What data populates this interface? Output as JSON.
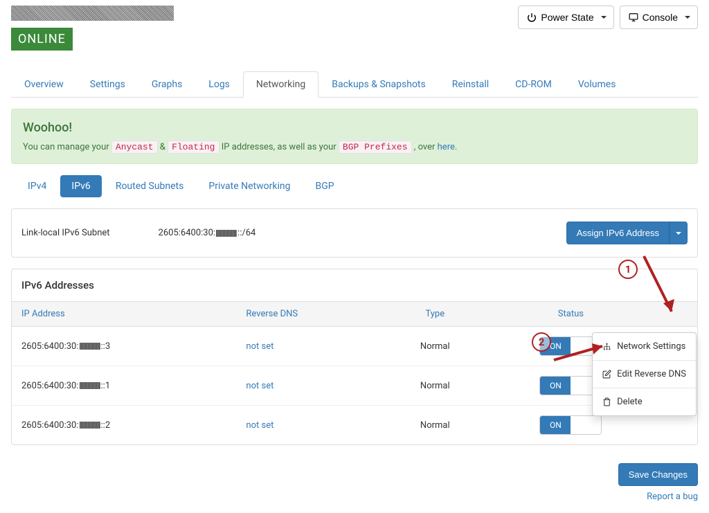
{
  "header": {
    "status_badge": "ONLINE",
    "power_btn": "Power State",
    "console_btn": "Console"
  },
  "tabs": [
    "Overview",
    "Settings",
    "Graphs",
    "Logs",
    "Networking",
    "Backups & Snapshots",
    "Reinstall",
    "CD-ROM",
    "Volumes"
  ],
  "alert": {
    "title": "Woohoo!",
    "pre": "You can manage your",
    "tag1": "Anycast",
    "amp": "&",
    "tag2": "Floating",
    "mid": "IP addresses, as well as your",
    "tag3": "BGP Prefixes",
    "post": ", over",
    "link": "here",
    "dot": "."
  },
  "subtabs": [
    "IPv4",
    "IPv6",
    "Routed Subnets",
    "Private Networking",
    "BGP"
  ],
  "subnet_panel": {
    "label": "Link-local IPv6 Subnet",
    "value_pre": "2605:6400:30:",
    "value_post": "::/64",
    "assign_btn": "Assign IPv6 Address"
  },
  "addresses_panel": {
    "heading": "IPv6 Addresses",
    "cols": [
      "IP Address",
      "Reverse DNS",
      "Type",
      "Status"
    ],
    "rows": [
      {
        "ip_pre": "2605:6400:30:",
        "ip_post": "::3",
        "rdns": "not set",
        "type": "Normal",
        "status": "ON"
      },
      {
        "ip_pre": "2605:6400:30:",
        "ip_post": "::1",
        "rdns": "not set",
        "type": "Normal",
        "status": "ON"
      },
      {
        "ip_pre": "2605:6400:30:",
        "ip_post": "::2",
        "rdns": "not set",
        "type": "Normal",
        "status": "ON"
      }
    ]
  },
  "dropdown": {
    "network_settings": "Network Settings",
    "edit_rdns": "Edit Reverse DNS",
    "delete": "Delete"
  },
  "save_btn": "Save Changes",
  "report_link": "Report a bug",
  "annotations": {
    "one": "1",
    "two": "2"
  }
}
